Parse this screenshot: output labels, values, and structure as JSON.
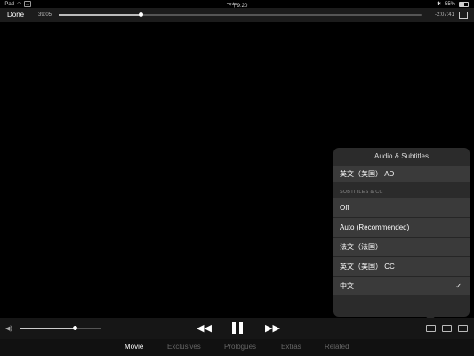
{
  "status_bar": {
    "device": "iPad",
    "time": "下午9:20",
    "battery": "55%",
    "battery_level": 0.55
  },
  "player": {
    "done_label": "Done",
    "elapsed": "39:05",
    "remaining": "-2:07:41",
    "progress": 0.225
  },
  "popover": {
    "title": "Audio & Subtitles",
    "audio_items": [
      "英文（美国） AD"
    ],
    "subtitles_header": "SUBTITLES & CC",
    "subtitle_items": [
      {
        "label": "Off",
        "selected": false
      },
      {
        "label": "Auto (Recommended)",
        "selected": false
      },
      {
        "label": "法文（法国）",
        "selected": false
      },
      {
        "label": "英文（美国） CC",
        "selected": false
      },
      {
        "label": "中文",
        "selected": true
      }
    ],
    "check_glyph": "✓"
  },
  "volume": {
    "level": 0.67
  },
  "tabs": [
    "Movie",
    "Exclusives",
    "Prologues",
    "Extras",
    "Related"
  ],
  "active_tab": 0,
  "icons": {
    "wifi": "wifi-icon",
    "bluetooth": "bluetooth-icon",
    "battery": "battery-icon",
    "aspect": "aspect-ratio-icon",
    "volume": "speaker-icon",
    "rewind": "rewind-icon",
    "pause": "pause-icon",
    "forward": "fast-forward-icon",
    "subtitles": "subtitles-icon",
    "airplay": "airplay-icon",
    "pip": "picture-in-picture-icon"
  }
}
